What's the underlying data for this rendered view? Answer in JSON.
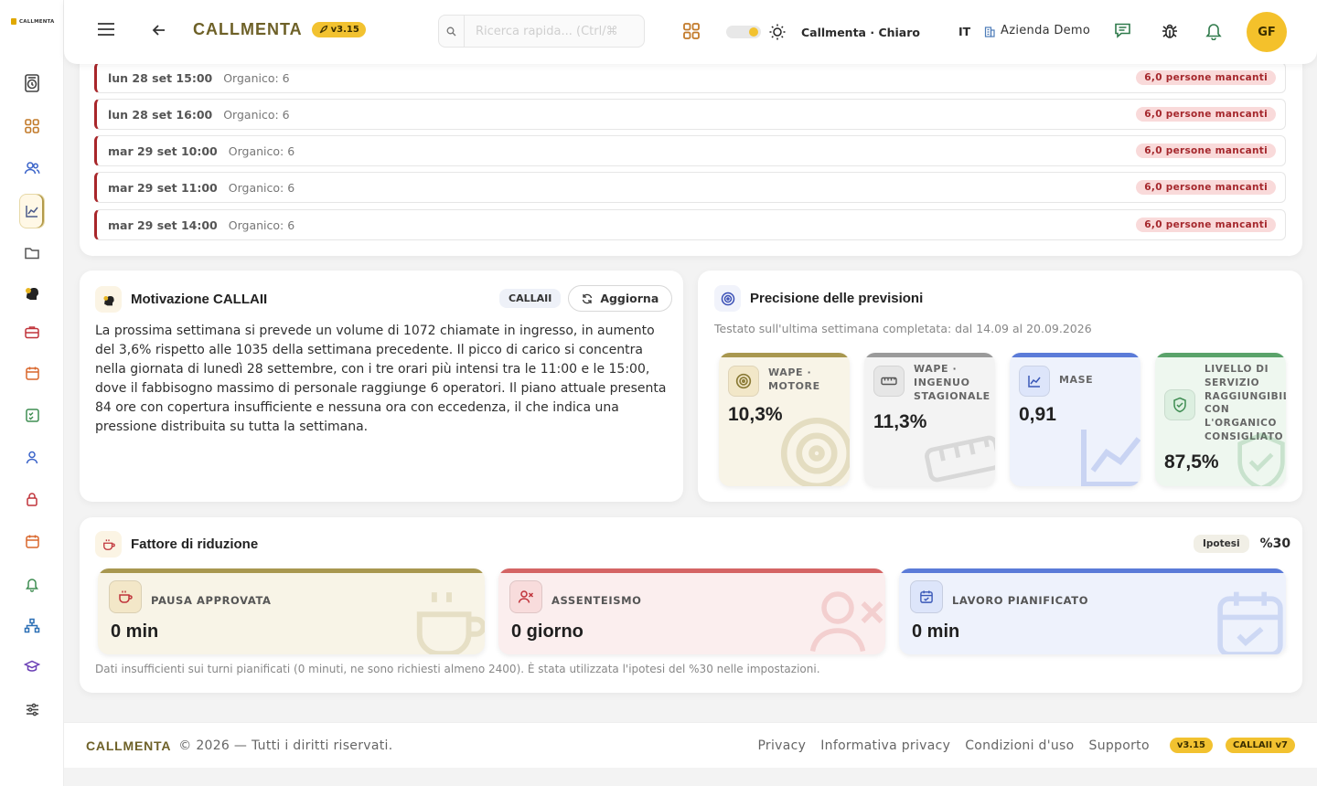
{
  "app": {
    "logo_text": "CALLMENTA",
    "brand": "CALLMENTA",
    "version": "v3.15"
  },
  "header": {
    "search_placeholder": "Ricerca rapida... (Ctrl/⌘",
    "theme_label": "Callmenta · Chiaro",
    "language": "IT",
    "company": "Azienda Demo",
    "avatar_initials": "GF"
  },
  "shortage_rows": [
    {
      "when": "lun 28 set 15:00",
      "staff": "Organico: 6",
      "missing": "6,0 persone mancanti"
    },
    {
      "when": "lun 28 set 16:00",
      "staff": "Organico: 6",
      "missing": "6,0 persone mancanti"
    },
    {
      "when": "mar 29 set 10:00",
      "staff": "Organico: 6",
      "missing": "6,0 persone mancanti"
    },
    {
      "when": "mar 29 set 11:00",
      "staff": "Organico: 6",
      "missing": "6,0 persone mancanti"
    },
    {
      "when": "mar 29 set 14:00",
      "staff": "Organico: 6",
      "missing": "6,0 persone mancanti"
    }
  ],
  "motivation": {
    "title": "Motivazione CALLAII",
    "badge": "CALLAII",
    "refresh_label": "Aggiorna",
    "text": "La prossima settimana si prevede un volume di 1072 chiamate in ingresso, in aumento del 3,6% rispetto alle 1035 della settimana precedente. Il picco di carico si concentra nella giornata di lunedì 28 settembre, con i tre orari più intensi tra le 11:00 e le 15:00, dove il fabbisogno massimo di personale raggiunge 6 operatori. Il piano attuale presenta 84 ore con copertura insufficiente e nessuna ora con eccedenza, il che indica una pressione distribuita su tutta la settimana."
  },
  "accuracy": {
    "title": "Precisione delle previsioni",
    "subtitle": "Testato sull'ultima settimana completata: dal 14.09 al 20.09.2026",
    "kpis": [
      {
        "label": "WAPE · MOTORE",
        "value": "10,3%",
        "icon": "target-icon",
        "accent": "#a8974f"
      },
      {
        "label": "WAPE · INGENUO STAGIONALE",
        "value": "11,3%",
        "icon": "ruler-icon",
        "accent": "#9a9a9a"
      },
      {
        "label": "MASE",
        "value": "0,91",
        "icon": "line-chart-icon",
        "accent": "#5b7bd8"
      },
      {
        "label": "LIVELLO DI SERVIZIO RAGGIUNGIBILE CON L'ORGANICO CONSIGLIATO",
        "value": "87,5%",
        "icon": "shield-check-icon",
        "accent": "#5aa36a"
      }
    ]
  },
  "reduction": {
    "title": "Fattore di riduzione",
    "badge": "Ipotesi",
    "value": "%30",
    "kpis": [
      {
        "label": "PAUSA APPROVATA",
        "value": "0 min",
        "icon": "coffee-icon",
        "accent": "#a8974f"
      },
      {
        "label": "ASSENTEISMO",
        "value": "0 giorno",
        "icon": "user-x-icon",
        "accent": "#d46464"
      },
      {
        "label": "LAVORO PIANIFICATO",
        "value": "0 min",
        "icon": "calendar-check-icon",
        "accent": "#5b7bd8"
      }
    ],
    "note": "Dati insufficienti sui turni pianificati (0 minuti, ne sono richiesti almeno 2400). È stata utilizzata l'ipotesi del %30 nelle impostazioni."
  },
  "footer": {
    "brand": "CALLMENTA",
    "copyright": "© 2026 — Tutti i diritti riservati.",
    "links": [
      "Privacy",
      "Informativa privacy",
      "Condizioni d'uso",
      "Supporto"
    ],
    "version": "v3.15",
    "ai_version": "CALLAII v7"
  }
}
